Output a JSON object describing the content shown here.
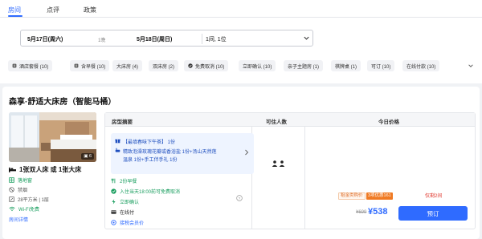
{
  "tabs": [
    {
      "label": "房间",
      "active": true
    },
    {
      "label": "点评",
      "active": false
    },
    {
      "label": "政策",
      "active": false
    }
  ],
  "booking": {
    "checkin": "5月17日(周六)",
    "nights": "1晚",
    "checkout": "5月18日(周日)",
    "rooms_guests": "1间, 1位"
  },
  "filters": [
    {
      "icon": "utensils-icon",
      "label": "酒店套餐 (10)"
    },
    {
      "icon": "utensils-icon",
      "label": "含早餐 (10)"
    },
    {
      "icon": "",
      "label": "大床房 (4)"
    },
    {
      "icon": "",
      "label": "双床房 (2)"
    },
    {
      "icon": "check-circle-icon",
      "label": "免费取消 (10)"
    },
    {
      "icon": "",
      "label": "立即确认 (10)"
    },
    {
      "icon": "",
      "label": "亲子主题房 (1)"
    },
    {
      "icon": "",
      "label": "棋牌桌 (1)"
    },
    {
      "icon": "",
      "label": "可订 (10)"
    },
    {
      "icon": "",
      "label": "在线付款 (10)"
    }
  ],
  "room": {
    "title": "森享·舒适大床房（智能马桶）",
    "photo_count": "6",
    "bed": "1张双人床 或 1张大床",
    "window": "落地窗",
    "smoking": "禁烟",
    "size_floor": "28平方米 | 1层",
    "wifi": "Wi-Fi免费",
    "details_link": "房间详情"
  },
  "table": {
    "col_summary": "房型摘要",
    "col_guests": "可住人数",
    "col_price": "今日价格"
  },
  "package": {
    "line1": "【最填春味下午茶】 1份",
    "line2": "精致泡澡玫瑰花瓣或香浴盐 1份+汤山天然莲",
    "line3": "温泉 1份+手工伴手礼 1份"
  },
  "features": [
    {
      "icon": "utensils-icon",
      "label": "2份早餐",
      "color": "#1a9e5f"
    },
    {
      "icon": "check-circle-icon",
      "label": "入住当天18:00前可免费取消",
      "color": "#1a9e5f"
    },
    {
      "icon": "bolt-icon",
      "label": "立即确认",
      "color": "#1a9e5f"
    },
    {
      "icon": "card-icon",
      "label": "在线付",
      "color": "#222222"
    },
    {
      "icon": "member-icon",
      "label": "接税会员价",
      "color": "#2f6bff"
    }
  ],
  "price": {
    "guest_tag": "租金类购价",
    "deal_tag": "3项优惠161",
    "limited": "仅剩2间",
    "old_price": "¥699",
    "new_price": "¥538",
    "book_button": "预订"
  },
  "colors": {
    "accent": "#2f6bff",
    "green": "#1a9e5f",
    "orange": "#f07a23",
    "red": "#e0352b"
  }
}
